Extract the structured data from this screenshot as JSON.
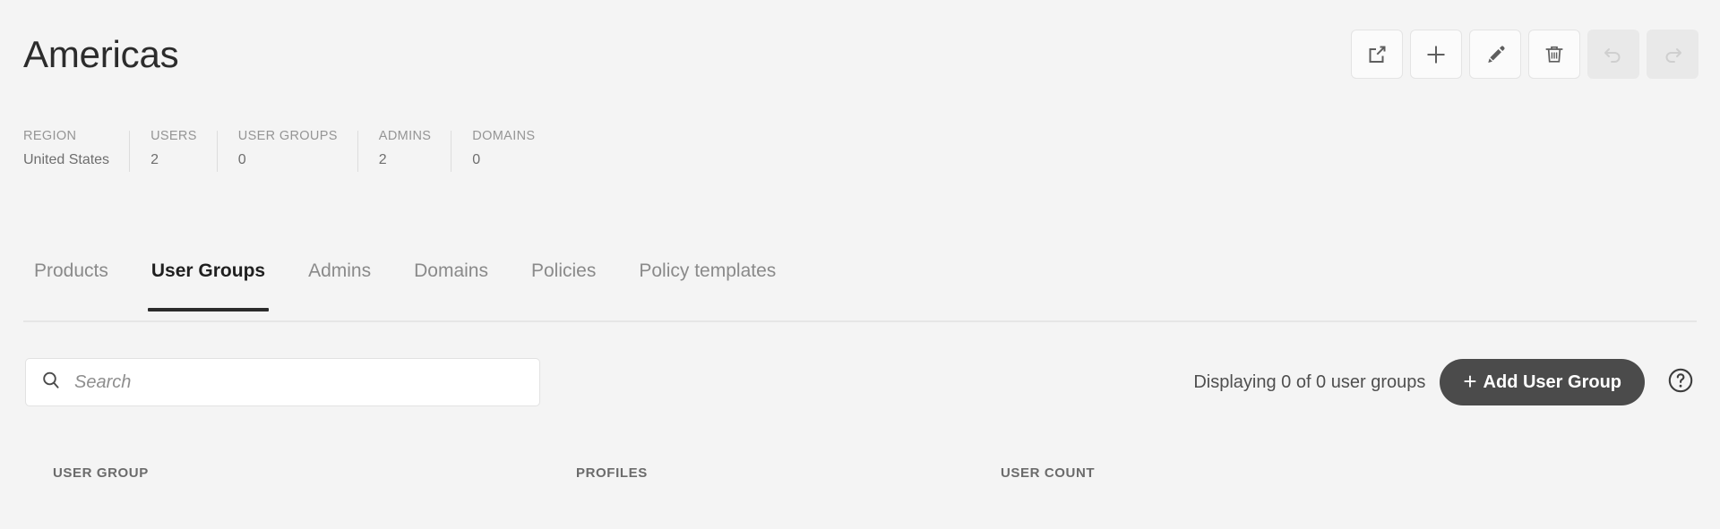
{
  "header": {
    "title": "Americas"
  },
  "toolbar": {
    "buttons": [
      {
        "name": "export-icon",
        "label": "Export",
        "disabled": false
      },
      {
        "name": "plus-icon",
        "label": "Add",
        "disabled": false
      },
      {
        "name": "pencil-icon",
        "label": "Edit",
        "disabled": false
      },
      {
        "name": "trash-icon",
        "label": "Delete",
        "disabled": false
      },
      {
        "name": "undo-icon",
        "label": "Undo",
        "disabled": true
      },
      {
        "name": "redo-icon",
        "label": "Redo",
        "disabled": true
      }
    ]
  },
  "stats": [
    {
      "label": "REGION",
      "value": "United States"
    },
    {
      "label": "USERS",
      "value": "2"
    },
    {
      "label": "USER GROUPS",
      "value": "0"
    },
    {
      "label": "ADMINS",
      "value": "2"
    },
    {
      "label": "DOMAINS",
      "value": "0"
    }
  ],
  "tabs": [
    {
      "label": "Products",
      "active": false
    },
    {
      "label": "User Groups",
      "active": true
    },
    {
      "label": "Admins",
      "active": false
    },
    {
      "label": "Domains",
      "active": false
    },
    {
      "label": "Policies",
      "active": false
    },
    {
      "label": "Policy templates",
      "active": false
    }
  ],
  "search": {
    "placeholder": "Search",
    "value": ""
  },
  "controls": {
    "displaying_text": "Displaying 0 of 0 user groups",
    "add_button_label": "Add User Group",
    "add_button_plus": "+",
    "help_label": "?"
  },
  "table": {
    "columns": [
      "USER GROUP",
      "PROFILES",
      "USER COUNT"
    ],
    "rows": []
  },
  "colors": {
    "page_background": "#f4f4f4",
    "title_text": "#2c2c2c",
    "muted_text": "#959595",
    "accent_dark": "#4b4b4b",
    "active_tab_underline": "#2b2b2b",
    "field_background": "#ffffff",
    "border": "#e2e2e2"
  }
}
